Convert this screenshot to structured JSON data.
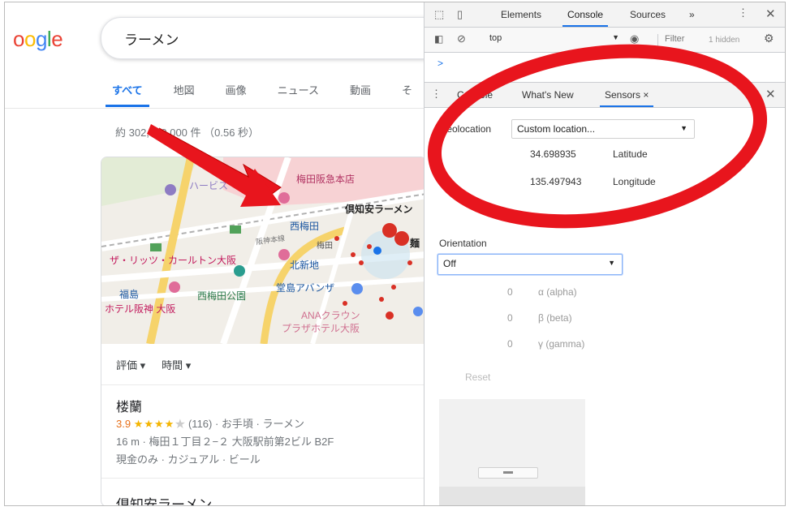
{
  "google": {
    "logo_letters": [
      "o",
      "o",
      "g",
      "l",
      "e"
    ],
    "search_query": "ラーメン",
    "tabs": [
      {
        "label": "すべて"
      },
      {
        "label": "地図"
      },
      {
        "label": "画像"
      },
      {
        "label": "ニュース"
      },
      {
        "label": "動画"
      },
      {
        "label": "そ"
      }
    ],
    "result_stats": "約 302,000,000 件 （0.56 秒）",
    "map_labels": {
      "l1": "梅田阪急本店",
      "l2": "倶知安ラーメン",
      "l3": "西梅田",
      "l4": "梅田",
      "l5": "北新地",
      "l6": "ザ・リッツ・カールトン大阪",
      "l7": "福島",
      "l8": "ホテル阪神 大阪",
      "l9": "西梅田公園",
      "l10": "堂島アバンザ",
      "l11": "ANAクラウン",
      "l12": "プラザホテル大阪",
      "l13": "ハービス",
      "l14": "阪神本線",
      "l15": "麺"
    },
    "filters": [
      {
        "label": "評価 ▾"
      },
      {
        "label": "時間 ▾"
      }
    ],
    "place1": {
      "name": "楼蘭",
      "rating": "3.9",
      "stars": "★★★★",
      "star_empty": "★",
      "review_meta": "(116) · お手頃 · ラーメン",
      "address": "16 m · 梅田１丁目２−２ 大阪駅前第2ビル B2F",
      "attributes": "現金のみ · カジュアル · ビール"
    },
    "place2": {
      "name": "倶知安ラーメン"
    }
  },
  "devtools": {
    "main_tabs": [
      {
        "label": "Elements"
      },
      {
        "label": "Console"
      },
      {
        "label": "Sources"
      },
      {
        "label": "»"
      }
    ],
    "context": "top",
    "filter_placeholder": "Filter",
    "hidden_count": "1 hidden",
    "prompt": ">",
    "drawer_tabs": [
      {
        "label": "Console"
      },
      {
        "label": "What's New"
      },
      {
        "label": "Sensors ×"
      }
    ],
    "sensors": {
      "geolocation_label": "Geolocation",
      "geolocation_value": "Custom location...",
      "latitude_value": "34.698935",
      "latitude_label": "Latitude",
      "longitude_value": "135.497943",
      "longitude_label": "Longitude",
      "orientation_label": "Orientation",
      "orientation_value": "Off",
      "alpha_value": "0",
      "alpha_label": "α (alpha)",
      "beta_value": "0",
      "beta_label": "β (beta)",
      "gamma_value": "0",
      "gamma_label": "γ (gamma)",
      "reset_label": "Reset"
    }
  },
  "colors": {
    "accent_blue": "#1a73e8",
    "annotation_red": "#e8151d"
  }
}
